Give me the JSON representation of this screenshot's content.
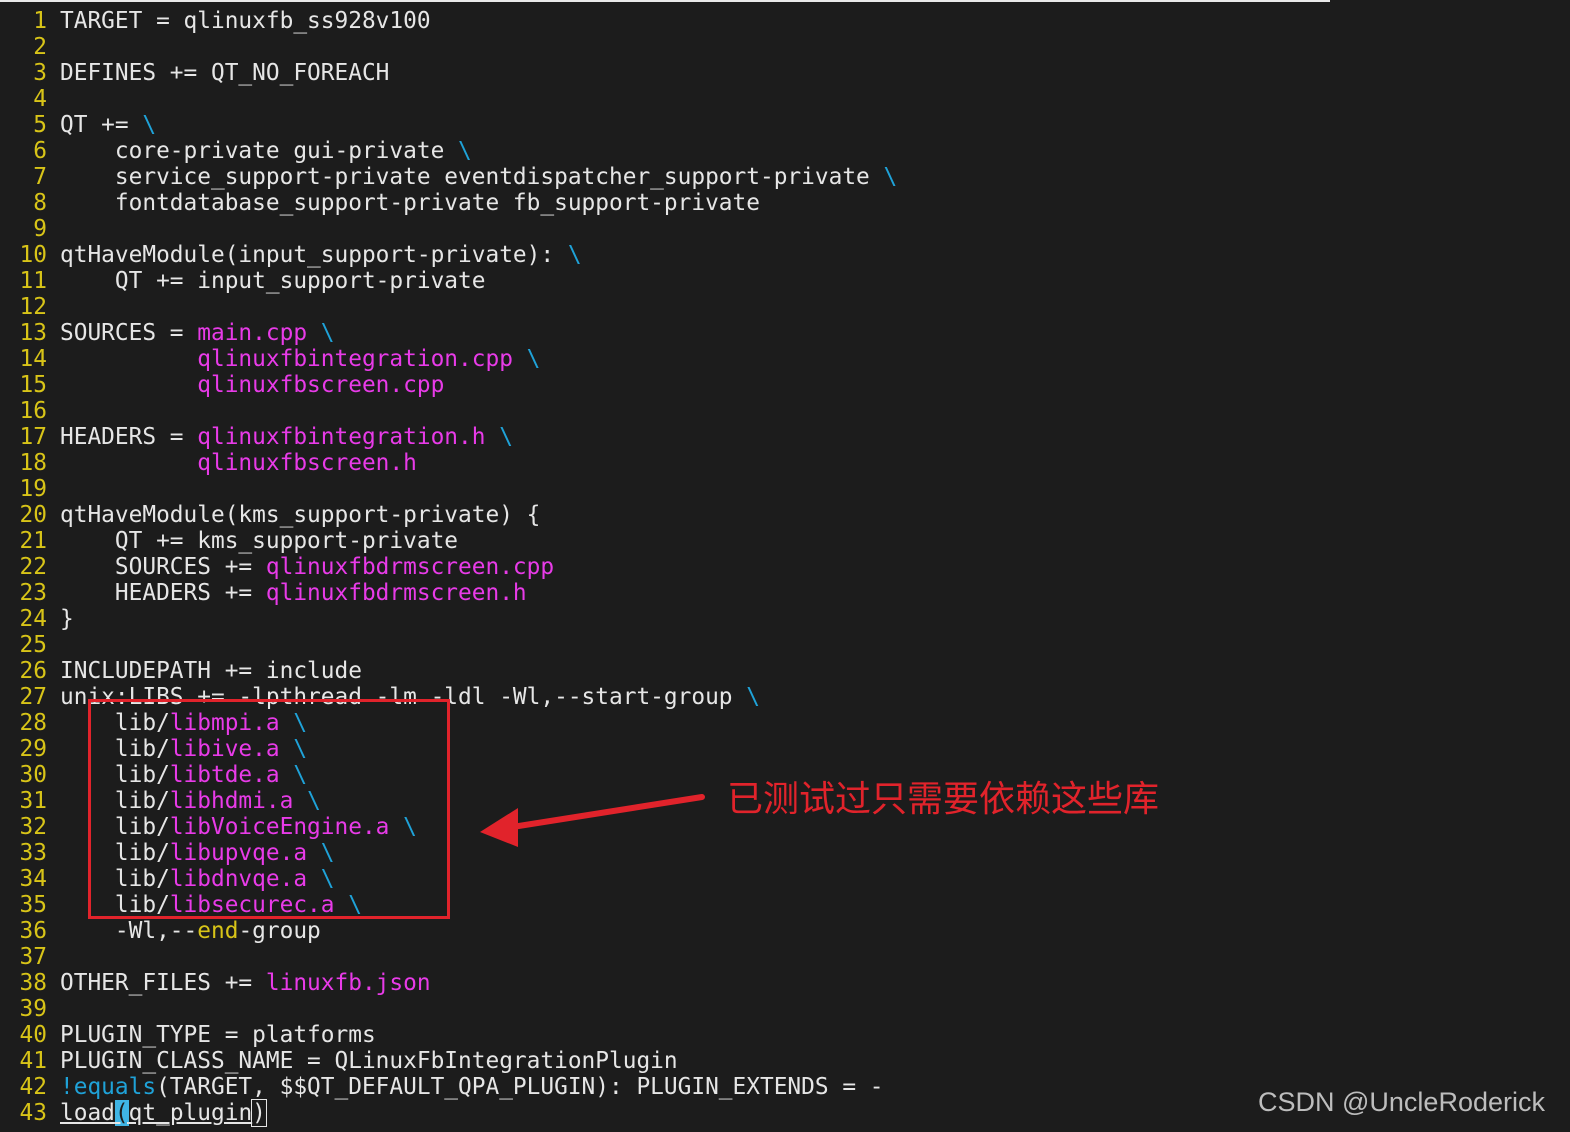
{
  "editor": {
    "lines": [
      {
        "n": "1",
        "segs": [
          [
            "t",
            "TARGET = qlinuxfb_ss928v100"
          ]
        ]
      },
      {
        "n": "2",
        "segs": []
      },
      {
        "n": "3",
        "segs": [
          [
            "t",
            "DEFINES += QT_NO_FOREACH"
          ]
        ]
      },
      {
        "n": "4",
        "segs": []
      },
      {
        "n": "5",
        "segs": [
          [
            "t",
            "QT += "
          ],
          [
            "c",
            "\\"
          ]
        ]
      },
      {
        "n": "6",
        "segs": [
          [
            "t",
            "    core-private gui-private "
          ],
          [
            "c",
            "\\"
          ]
        ]
      },
      {
        "n": "7",
        "segs": [
          [
            "t",
            "    service_support-private eventdispatcher_support-private "
          ],
          [
            "c",
            "\\"
          ]
        ]
      },
      {
        "n": "8",
        "segs": [
          [
            "t",
            "    fontdatabase_support-private fb_support-private"
          ]
        ]
      },
      {
        "n": "9",
        "segs": []
      },
      {
        "n": "10",
        "segs": [
          [
            "t",
            "qtHaveModule(input_support-private): "
          ],
          [
            "c",
            "\\"
          ]
        ]
      },
      {
        "n": "11",
        "segs": [
          [
            "t",
            "    QT += input_support-private"
          ]
        ]
      },
      {
        "n": "12",
        "segs": []
      },
      {
        "n": "13",
        "segs": [
          [
            "t",
            "SOURCES = "
          ],
          [
            "m",
            "main.cpp"
          ],
          [
            "t",
            " "
          ],
          [
            "c",
            "\\"
          ]
        ]
      },
      {
        "n": "14",
        "segs": [
          [
            "t",
            "          "
          ],
          [
            "m",
            "qlinuxfbintegration.cpp"
          ],
          [
            "t",
            " "
          ],
          [
            "c",
            "\\"
          ]
        ]
      },
      {
        "n": "15",
        "segs": [
          [
            "t",
            "          "
          ],
          [
            "m",
            "qlinuxfbscreen.cpp"
          ]
        ]
      },
      {
        "n": "16",
        "segs": []
      },
      {
        "n": "17",
        "segs": [
          [
            "t",
            "HEADERS = "
          ],
          [
            "m",
            "qlinuxfbintegration.h"
          ],
          [
            "t",
            " "
          ],
          [
            "c",
            "\\"
          ]
        ]
      },
      {
        "n": "18",
        "segs": [
          [
            "t",
            "          "
          ],
          [
            "m",
            "qlinuxfbscreen.h"
          ]
        ]
      },
      {
        "n": "19",
        "segs": []
      },
      {
        "n": "20",
        "segs": [
          [
            "t",
            "qtHaveModule(kms_support-private) {"
          ]
        ]
      },
      {
        "n": "21",
        "segs": [
          [
            "t",
            "    QT += kms_support-private"
          ]
        ]
      },
      {
        "n": "22",
        "segs": [
          [
            "t",
            "    SOURCES += "
          ],
          [
            "m",
            "qlinuxfbdrmscreen.cpp"
          ]
        ]
      },
      {
        "n": "23",
        "segs": [
          [
            "t",
            "    HEADERS += "
          ],
          [
            "m",
            "qlinuxfbdrmscreen.h"
          ]
        ]
      },
      {
        "n": "24",
        "segs": [
          [
            "t",
            "}"
          ]
        ]
      },
      {
        "n": "25",
        "segs": []
      },
      {
        "n": "26",
        "segs": [
          [
            "t",
            "INCLUDEPATH += include"
          ]
        ]
      },
      {
        "n": "27",
        "segs": [
          [
            "t",
            "unix:LIBS += -lpthread -lm -ldl -Wl,--start-group "
          ],
          [
            "c",
            "\\"
          ]
        ]
      },
      {
        "n": "28",
        "segs": [
          [
            "t",
            "    lib/"
          ],
          [
            "m",
            "libmpi.a"
          ],
          [
            "t",
            " "
          ],
          [
            "c",
            "\\"
          ]
        ]
      },
      {
        "n": "29",
        "segs": [
          [
            "t",
            "    lib/"
          ],
          [
            "m",
            "libive.a"
          ],
          [
            "t",
            " "
          ],
          [
            "c",
            "\\"
          ]
        ]
      },
      {
        "n": "30",
        "segs": [
          [
            "t",
            "    lib/"
          ],
          [
            "m",
            "libtde.a"
          ],
          [
            "t",
            " "
          ],
          [
            "c",
            "\\"
          ]
        ]
      },
      {
        "n": "31",
        "segs": [
          [
            "t",
            "    lib/"
          ],
          [
            "m",
            "libhdmi.a"
          ],
          [
            "t",
            " "
          ],
          [
            "c",
            "\\"
          ]
        ]
      },
      {
        "n": "32",
        "segs": [
          [
            "t",
            "    lib/"
          ],
          [
            "m",
            "libVoiceEngine.a"
          ],
          [
            "t",
            " "
          ],
          [
            "c",
            "\\"
          ]
        ]
      },
      {
        "n": "33",
        "segs": [
          [
            "t",
            "    lib/"
          ],
          [
            "m",
            "libupvqe.a"
          ],
          [
            "t",
            " "
          ],
          [
            "c",
            "\\"
          ]
        ]
      },
      {
        "n": "34",
        "segs": [
          [
            "t",
            "    lib/"
          ],
          [
            "m",
            "libdnvqe.a"
          ],
          [
            "t",
            " "
          ],
          [
            "c",
            "\\"
          ]
        ]
      },
      {
        "n": "35",
        "segs": [
          [
            "t",
            "    lib/"
          ],
          [
            "m",
            "libsecurec.a"
          ],
          [
            "t",
            " "
          ],
          [
            "c",
            "\\"
          ]
        ]
      },
      {
        "n": "36",
        "segs": [
          [
            "t",
            "    -Wl,--"
          ],
          [
            "k",
            "end"
          ],
          [
            "t",
            "-group"
          ]
        ]
      },
      {
        "n": "37",
        "segs": []
      },
      {
        "n": "38",
        "segs": [
          [
            "t",
            "OTHER_FILES += "
          ],
          [
            "m",
            "linuxfb.json"
          ]
        ]
      },
      {
        "n": "39",
        "segs": []
      },
      {
        "n": "40",
        "segs": [
          [
            "t",
            "PLUGIN_TYPE = platforms"
          ]
        ]
      },
      {
        "n": "41",
        "segs": [
          [
            "t",
            "PLUGIN_CLASS_NAME = QLinuxFbIntegrationPlugin"
          ]
        ]
      },
      {
        "n": "42",
        "segs": [
          [
            "f",
            "!equals"
          ],
          [
            "t",
            "(TARGET, $$QT_DEFAULT_QPA_PLUGIN): PLUGIN_EXTENDS = -"
          ]
        ]
      },
      {
        "n": "43",
        "segs": [
          [
            "u",
            "load"
          ],
          [
            "ca",
            "("
          ],
          [
            "u",
            "qt_plugin"
          ],
          [
            "cb",
            ")"
          ]
        ]
      }
    ]
  },
  "annotation": {
    "text": "已测试过只需要依赖这些库",
    "color": "#e1232b"
  },
  "watermark": {
    "text": "CSDN @UncleRoderick"
  },
  "colors": {
    "background": "#1c1c1c",
    "line_number": "#d8c418",
    "string": "#e83be8",
    "continuation": "#1fa2d8",
    "text": "#e6e6e6"
  }
}
